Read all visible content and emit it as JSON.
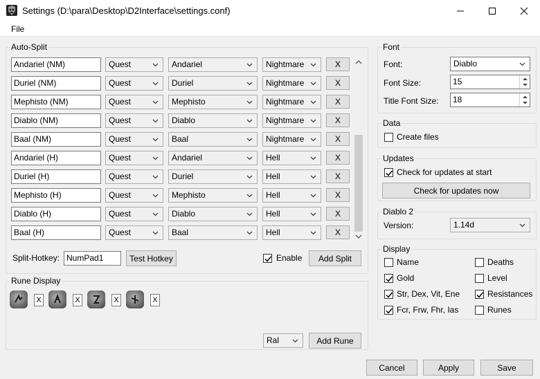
{
  "window": {
    "title": "Settings (D:\\para\\Desktop\\D2Interface\\settings.conf)"
  },
  "menu": {
    "file_label": "File"
  },
  "autosplit": {
    "group_label": "Auto-Split",
    "rows": [
      {
        "name": "Andariel (NM)",
        "type": "Quest",
        "value": "Andariel",
        "difficulty": "Nightmare",
        "remove": "X"
      },
      {
        "name": "Duriel (NM)",
        "type": "Quest",
        "value": "Duriel",
        "difficulty": "Nightmare",
        "remove": "X"
      },
      {
        "name": "Mephisto (NM)",
        "type": "Quest",
        "value": "Mephisto",
        "difficulty": "Nightmare",
        "remove": "X"
      },
      {
        "name": "Diablo (NM)",
        "type": "Quest",
        "value": "Diablo",
        "difficulty": "Nightmare",
        "remove": "X"
      },
      {
        "name": "Baal (NM)",
        "type": "Quest",
        "value": "Baal",
        "difficulty": "Nightmare",
        "remove": "X"
      },
      {
        "name": "Andariel (H)",
        "type": "Quest",
        "value": "Andariel",
        "difficulty": "Hell",
        "remove": "X"
      },
      {
        "name": "Duriel (H)",
        "type": "Quest",
        "value": "Duriel",
        "difficulty": "Hell",
        "remove": "X"
      },
      {
        "name": "Mephisto (H)",
        "type": "Quest",
        "value": "Mephisto",
        "difficulty": "Hell",
        "remove": "X"
      },
      {
        "name": "Diablo (H)",
        "type": "Quest",
        "value": "Diablo",
        "difficulty": "Hell",
        "remove": "X"
      },
      {
        "name": "Baal (H)",
        "type": "Quest",
        "value": "Baal",
        "difficulty": "Hell",
        "remove": "X"
      }
    ],
    "hotkey_label": "Split-Hotkey:",
    "hotkey_value": "NumPad1",
    "test_hotkey": "Test Hotkey",
    "enable_label": "Enable",
    "enable_checked": true,
    "add_split": "Add Split"
  },
  "rune_display": {
    "group_label": "Rune Display",
    "runes": [
      {
        "icon": "rune-icon",
        "remove": "X"
      },
      {
        "icon": "rune-icon",
        "remove": "X"
      },
      {
        "icon": "rune-icon",
        "remove": "X"
      },
      {
        "icon": "rune-icon",
        "remove": "X"
      }
    ],
    "selected_rune": "Ral",
    "add_rune": "Add Rune"
  },
  "font": {
    "group_label": "Font",
    "font_label": "Font:",
    "font_value": "Diablo",
    "size_label": "Font Size:",
    "size_value": "15",
    "title_size_label": "Title Font Size:",
    "title_size_value": "18"
  },
  "data": {
    "group_label": "Data",
    "create_files_label": "Create files",
    "create_files_checked": false
  },
  "updates": {
    "group_label": "Updates",
    "check_start_label": "Check for updates at start",
    "check_start_checked": true,
    "check_now": "Check for updates now"
  },
  "diablo2": {
    "group_label": "Diablo 2",
    "version_label": "Version:",
    "version_value": "1.14d"
  },
  "display": {
    "group_label": "Display",
    "options": [
      {
        "label": "Name",
        "checked": false
      },
      {
        "label": "Deaths",
        "checked": false
      },
      {
        "label": "Gold",
        "checked": true
      },
      {
        "label": "Level",
        "checked": false
      },
      {
        "label": "Str, Dex, Vit, Ene",
        "checked": true
      },
      {
        "label": "Resistances",
        "checked": true
      },
      {
        "label": "Fcr, Frw, Fhr, Ias",
        "checked": true
      },
      {
        "label": "Runes",
        "checked": false
      }
    ]
  },
  "footer": {
    "cancel": "Cancel",
    "apply": "Apply",
    "save": "Save"
  },
  "colors": {
    "accent": "#0078d7",
    "window_bg": "#f0f0f0"
  }
}
